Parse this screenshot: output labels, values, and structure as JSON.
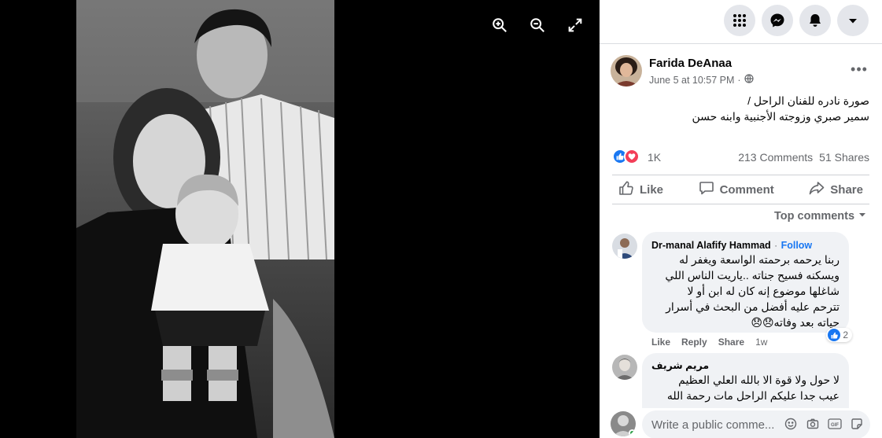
{
  "post": {
    "author": "Farida DeAnaa",
    "date": "June 5 at 10:57 PM",
    "audience_icon": "globe-icon",
    "text_line1": "صورة نادره للفنان الراحل /",
    "text_line2": "سمير صبري وزوجته الأجنبية وابنه حسن",
    "reaction_count": "1K",
    "comments_count": "213 Comments",
    "shares_count": "51 Shares"
  },
  "actions": {
    "like": "Like",
    "comment": "Comment",
    "share": "Share"
  },
  "sort_label": "Top comments",
  "comments": [
    {
      "author": "Dr-manal Alafify Hammad",
      "separator": "·",
      "follow": "Follow",
      "line1": "ربنا يرحمه برحمته الواسعة ويغفر له",
      "line2": "ويسكنه فسيح جناته ..ياريت الناس اللي",
      "line3": "شاغلها موضوع إنه كان له ابن أو لا",
      "line4": "تترحم عليه أفضل من البحث في أسرار",
      "line5": "حياته بعد وفاته😞😞",
      "reaction_count": "2",
      "like": "Like",
      "reply": "Reply",
      "share": "Share",
      "time": "1w"
    },
    {
      "author": "مريم شريف",
      "line1": "لا حول ولا قوة الا بالله العلي العظيم",
      "line2": "عيب جدا عليكم الراحل مات رحمة الله"
    }
  ],
  "composer": {
    "placeholder": "Write a public comme..."
  },
  "colors": {
    "accent": "#1877f2",
    "secondary_text": "#65676b",
    "bubble": "#f0f2f5",
    "love": "#f33e58"
  },
  "icons": [
    "zoom-in-icon",
    "zoom-out-icon",
    "fullscreen-icon",
    "menu-grid-icon",
    "messenger-icon",
    "bell-icon",
    "caret-down-icon",
    "like-icon",
    "comment-icon",
    "share-icon",
    "emoji-icon",
    "camera-icon",
    "gif-icon",
    "sticker-icon"
  ]
}
